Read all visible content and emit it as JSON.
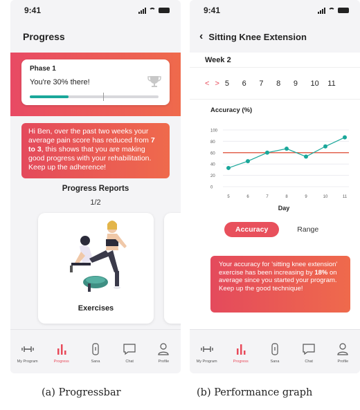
{
  "screen_a": {
    "time": "9:41",
    "title": "Progress",
    "phase": "Phase 1",
    "progress_text": "You're 30% there!",
    "progress_fraction": 0.3,
    "message_part1": "Hi Ben, over the past two weeks your average pain score has reduced from ",
    "message_bold": "7 to 3",
    "message_part2": ", this shows that you are making good progress with your rehabilitation. Keep up the adherence!",
    "reports_title": "Progress Reports",
    "reports_page": "1/2",
    "exercise_label": "Exercises"
  },
  "screen_b": {
    "time": "9:41",
    "back_icon": "chevron-left-icon",
    "title": "Sitting Knee Extension",
    "week": "Week 2",
    "day_numbers": [
      "5",
      "6",
      "7",
      "8",
      "9",
      "10",
      "11"
    ],
    "seg_active": "Accuracy",
    "seg_inactive": "Range",
    "message_part1": "Your accuracy for 'sitting knee extension' exercise has been increasing by ",
    "message_bold": "18%",
    "message_part2": " on average since you started your program. Keep up the good technique!"
  },
  "tabs": [
    {
      "label": "My Program",
      "icon": "dumbbell-icon"
    },
    {
      "label": "Progress",
      "icon": "bar-chart-icon"
    },
    {
      "label": "Sana",
      "icon": "phone-icon"
    },
    {
      "label": "Chat",
      "icon": "chat-bubble-icon"
    },
    {
      "label": "Profile",
      "icon": "person-icon"
    }
  ],
  "colors": {
    "accent": "#e84a5a",
    "teal": "#1aa79a",
    "gradient_start": "#e44a5c",
    "gradient_end": "#ef6a4c"
  },
  "chart_data": {
    "type": "line",
    "title": "Accuracy (%)",
    "xlabel": "Day",
    "ylabel": "",
    "x": [
      5,
      6,
      7,
      8,
      9,
      10,
      11
    ],
    "x_ticks": [
      "5",
      "6",
      "7",
      "8",
      "9",
      "10",
      "11"
    ],
    "y_ticks": [
      "100",
      "80",
      "60",
      "40",
      "20",
      "0"
    ],
    "ylim": [
      0,
      100
    ],
    "series": [
      {
        "values": [
          33,
          45,
          60,
          67,
          53,
          71,
          87
        ],
        "color": "#1aa79a"
      }
    ],
    "reference_line": {
      "value": 60,
      "color": "#e0553e"
    },
    "grid": "horizontal"
  },
  "captions": {
    "a": "(a) Progressbar",
    "b": "(b) Performance graph"
  }
}
